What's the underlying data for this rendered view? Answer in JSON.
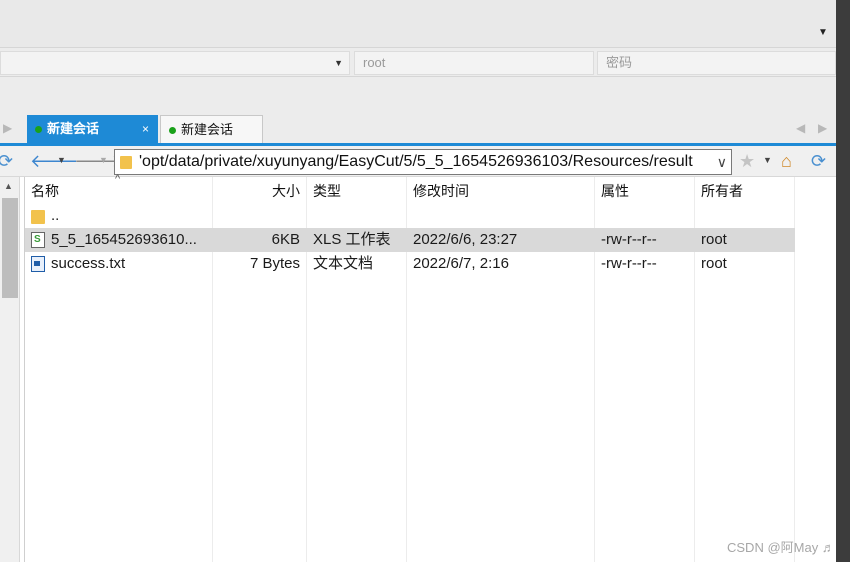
{
  "connection": {
    "host_value": "",
    "user_placeholder": "root",
    "password_placeholder": "密码"
  },
  "tabs": [
    {
      "label": "新建会话",
      "active": true,
      "close": "×"
    },
    {
      "label": "新建会话",
      "active": false
    }
  ],
  "toolbar": {
    "path": "'opt/data/private/xuyunyang/EasyCut/5/5_5_1654526936103/Resources/result"
  },
  "table": {
    "columns": [
      "名称",
      "大小",
      "类型",
      "修改时间",
      "属性",
      "所有者"
    ],
    "rows": [
      {
        "name": "..",
        "size": "",
        "type": "",
        "modified": "",
        "attrs": "",
        "owner": "",
        "icon": "folder-icon"
      },
      {
        "name": "5_5_165452693610...",
        "size": "6KB",
        "type": "XLS 工作表",
        "modified": "2022/6/6, 23:27",
        "attrs": "-rw-r--r--",
        "owner": "root",
        "icon": "xls-file-icon",
        "selected": true
      },
      {
        "name": "success.txt",
        "size": "7 Bytes",
        "type": "文本文档",
        "modified": "2022/6/7, 2:16",
        "attrs": "-rw-r--r--",
        "owner": "root",
        "icon": "txt-file-icon"
      }
    ]
  },
  "watermark": "CSDN @阿May ♬",
  "colors": {
    "tab_active": "#1e8ad6",
    "status_dot": "#1aa11a",
    "selected_row": "#d9d9d9",
    "folder": "#f2c24c"
  }
}
